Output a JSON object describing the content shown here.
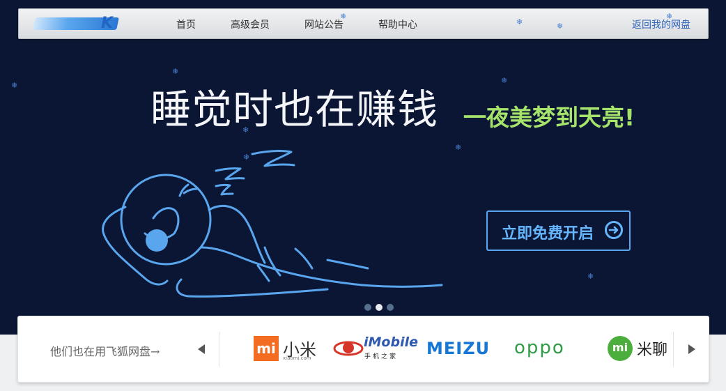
{
  "nav": {
    "logo_text": "K",
    "items": [
      "首页",
      "高级会员",
      "网站公告",
      "帮助中心"
    ],
    "return_link": "返回我的网盘"
  },
  "hero": {
    "headline": "睡觉时也在赚钱",
    "subheadline": "一夜美梦到天亮!",
    "cta_label": "立即免费开启",
    "carousel_count": 3,
    "carousel_active": 2
  },
  "partners": {
    "label": "他们也在用飞狐网盘→",
    "brands": {
      "xiaomi": {
        "mark": "mi",
        "name": "小米",
        "sub": "xiaomi.com"
      },
      "imobile": {
        "name": "iMobile",
        "sub": "手机之家"
      },
      "meizu": {
        "name": "MEIZU"
      },
      "oppo": {
        "name": "oppo"
      },
      "miliao": {
        "mark": "mi",
        "name": "米聊"
      }
    }
  },
  "colors": {
    "hero_bg": "#0a1633",
    "headline": "#f3f5f8",
    "subheadline": "#a6e36b",
    "cta": "#66b6ff",
    "link": "#2f63b8"
  }
}
